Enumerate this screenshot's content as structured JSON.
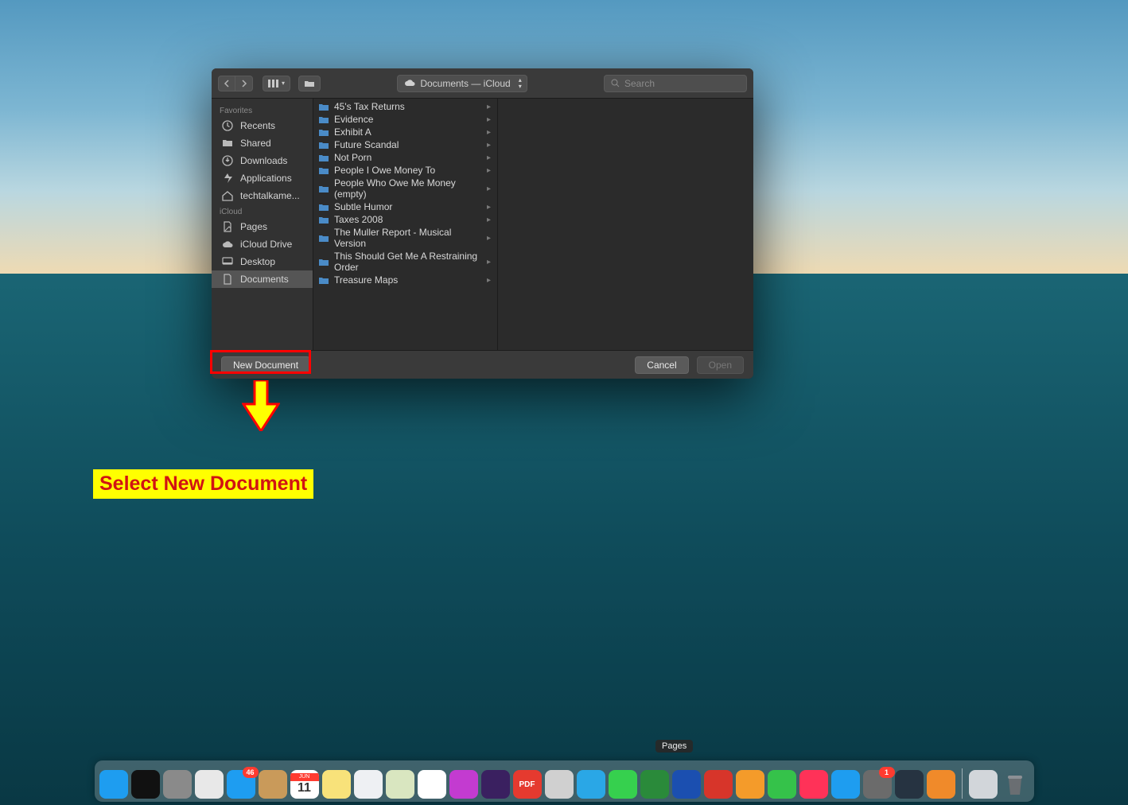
{
  "titlebar": {
    "path_label": "Documents — iCloud",
    "search_placeholder": "Search"
  },
  "sidebar": {
    "sections": [
      {
        "header": "Favorites",
        "items": [
          {
            "label": "Recents",
            "icon": "clock"
          },
          {
            "label": "Shared",
            "icon": "folder"
          },
          {
            "label": "Downloads",
            "icon": "download"
          },
          {
            "label": "Applications",
            "icon": "apps"
          },
          {
            "label": "techtalkame...",
            "icon": "home"
          }
        ]
      },
      {
        "header": "iCloud",
        "items": [
          {
            "label": "Pages",
            "icon": "pages"
          },
          {
            "label": "iCloud Drive",
            "icon": "cloud"
          },
          {
            "label": "Desktop",
            "icon": "desktop"
          },
          {
            "label": "Documents",
            "icon": "document",
            "selected": true
          }
        ]
      }
    ]
  },
  "files": [
    {
      "name": "45's Tax Returns"
    },
    {
      "name": "Evidence"
    },
    {
      "name": "Exhibit A"
    },
    {
      "name": "Future Scandal"
    },
    {
      "name": "Not Porn"
    },
    {
      "name": "People I Owe Money To"
    },
    {
      "name": "People Who Owe Me Money (empty)"
    },
    {
      "name": "Subtle Humor"
    },
    {
      "name": "Taxes 2008"
    },
    {
      "name": "The Muller Report - Musical Version"
    },
    {
      "name": "This Should Get Me A Restraining Order"
    },
    {
      "name": "Treasure Maps"
    }
  ],
  "footer": {
    "new_document": "New Document",
    "cancel": "Cancel",
    "open": "Open"
  },
  "annotation": {
    "text": "Select New Document"
  },
  "dock": {
    "tooltip": "Pages",
    "apps": [
      {
        "name": "finder",
        "bg": "#1e9df0"
      },
      {
        "name": "siri",
        "bg": "#111"
      },
      {
        "name": "launchpad",
        "bg": "#8a8a8a"
      },
      {
        "name": "chrome",
        "bg": "#e8e8e8"
      },
      {
        "name": "mail",
        "bg": "#1e9df1",
        "badge": "46"
      },
      {
        "name": "contacts",
        "bg": "#c99a5a"
      },
      {
        "name": "calendar",
        "bg": "#ffffff",
        "text": "11",
        "textcolor": "#333",
        "top": "JUN"
      },
      {
        "name": "notes",
        "bg": "#f8e27a"
      },
      {
        "name": "reminders",
        "bg": "#eef0f3"
      },
      {
        "name": "maps",
        "bg": "#d9e6c0"
      },
      {
        "name": "photos",
        "bg": "#ffffff"
      },
      {
        "name": "messages2",
        "bg": "#c33bd0"
      },
      {
        "name": "imovie",
        "bg": "#3a2060"
      },
      {
        "name": "pdf",
        "bg": "#e53a2f",
        "text": "PDF"
      },
      {
        "name": "clapper",
        "bg": "#d0d0d0"
      },
      {
        "name": "skype",
        "bg": "#2aa7e6"
      },
      {
        "name": "messages",
        "bg": "#36d04e"
      },
      {
        "name": "gauge",
        "bg": "#2a8a3a"
      },
      {
        "name": "malwarebytes",
        "bg": "#1b4fb0"
      },
      {
        "name": "1password",
        "bg": "#d7352a"
      },
      {
        "name": "pages",
        "bg": "#f49b2a"
      },
      {
        "name": "numbers",
        "bg": "#35c24a"
      },
      {
        "name": "news",
        "bg": "#ff3258"
      },
      {
        "name": "appstore",
        "bg": "#1e9df0"
      },
      {
        "name": "tools",
        "bg": "#6b6b6b",
        "badge": "1"
      },
      {
        "name": "quicktime",
        "bg": "#263341"
      },
      {
        "name": "vlc",
        "bg": "#f08a2a"
      }
    ],
    "right": [
      {
        "name": "downloads-stack",
        "bg": "#d2d6da"
      },
      {
        "name": "trash",
        "bg": "transparent"
      }
    ]
  }
}
